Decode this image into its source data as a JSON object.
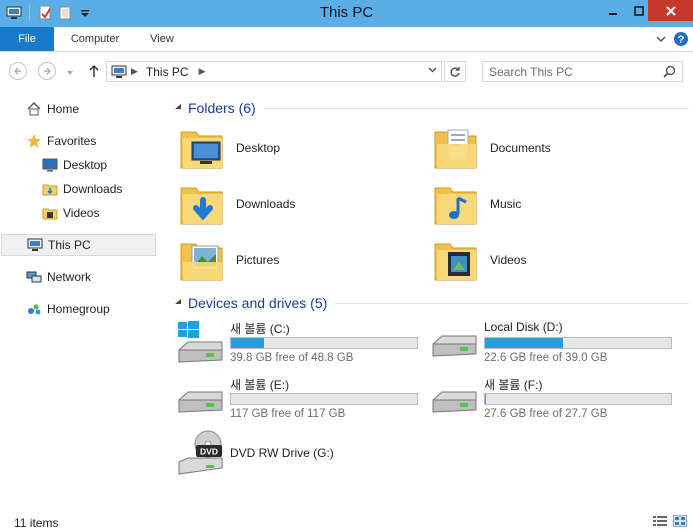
{
  "window": {
    "title": "This PC"
  },
  "ribbon": {
    "tabs": [
      {
        "label": "File"
      },
      {
        "label": "Computer"
      },
      {
        "label": "View"
      }
    ]
  },
  "address": {
    "path": "This PC",
    "search_placeholder": "Search This PC"
  },
  "nav": {
    "home": "Home",
    "favorites": "Favorites",
    "favorites_items": [
      "Desktop",
      "Downloads",
      "Videos"
    ],
    "this_pc": "This PC",
    "network": "Network",
    "homegroup": "Homegroup"
  },
  "folders": {
    "header": "Folders (6)",
    "items": [
      "Desktop",
      "Documents",
      "Downloads",
      "Music",
      "Pictures",
      "Videos"
    ]
  },
  "drives": {
    "header": "Devices and drives (5)",
    "items": [
      {
        "name": "새 볼륨 (C:)",
        "free_text": "39.8 GB free of 48.8 GB",
        "used_fraction": 0.18
      },
      {
        "name": "Local Disk (D:)",
        "free_text": "22.6 GB free of 39.0 GB",
        "used_fraction": 0.42
      },
      {
        "name": "새 볼륨 (E:)",
        "free_text": "117 GB free of 117 GB",
        "used_fraction": 0.0
      },
      {
        "name": "새 볼륨 (F:)",
        "free_text": "27.6 GB free of 27.7 GB",
        "used_fraction": 0.004
      },
      {
        "name": "DVD RW Drive (G:)",
        "dvd_label": "DVD"
      }
    ]
  },
  "status": {
    "item_count": "11 items"
  },
  "colors": {
    "titlebar": "#5aaee7",
    "file_tab": "#1979ca",
    "close_button": "#c7382a",
    "group_header": "#1e3c96",
    "drive_fill": "#26a0da"
  }
}
